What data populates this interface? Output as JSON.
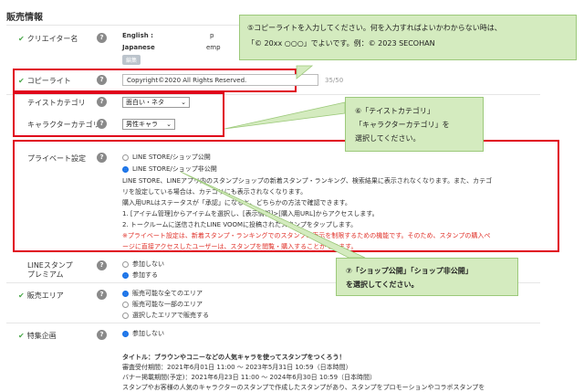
{
  "section_title": "販売情報",
  "creator": {
    "label": "クリエイター名",
    "english_label": "English :",
    "english_value": "p",
    "japanese_label": "Japanese",
    "japanese_value": "emp",
    "edit_button": "編集"
  },
  "copyright": {
    "label": "コピーライト",
    "value": "Copyright©2020 All Rights Reserved.",
    "counter": "35/50"
  },
  "taste": {
    "label": "テイストカテゴリ",
    "value": "面白い・ネタ"
  },
  "character": {
    "label": "キャラクターカテゴリ",
    "value": "男性キャラ"
  },
  "private": {
    "label": "プライベート設定",
    "options": [
      "LINE STORE/ショップ公開",
      "LINE STORE/ショップ非公開"
    ],
    "desc": [
      "LINE STORE、LINEアプリ内のスタンプショップの新着スタンプ・ランキング、検索結果に表示されなくなります。また、カテゴ",
      "リを設定している場合は、カテゴリにも表示されなくなります。",
      "購入用URLはステータスが「承認」になると、どちらかの方法で確認できます。",
      "1. [アイテム管理]からアイテムを選択し、[表示情報]>[購入用URL]からアクセスします。",
      "2. トークルームに送信されたLINE VOOMに投稿されたスタンプをタップします。"
    ],
    "warning": [
      "※プライベート設定は、新着スタンプ・ランキングでのスタンプの表示を制限するための機能です。そのため、スタンプの購入ペ",
      "ージに直接アクセスしたユーザーは、スタンプを閲覧・購入することができます。"
    ]
  },
  "premium": {
    "label1": "LINEスタンプ",
    "label2": "プレミアム",
    "options": [
      "参加しない",
      "参加する"
    ]
  },
  "area": {
    "label": "販売エリア",
    "options": [
      "販売可能な全てのエリア",
      "販売可能な一部のエリア",
      "選択したエリアで販売する"
    ]
  },
  "special": {
    "label": "特集企画",
    "option": "参加しない",
    "event_title": "タイトル：ブラウンやコニーなどの人気キャラを使ってスタンプをつくろう！",
    "event_period1": "審査受付期間：2021年6月01日 11:00 ～ 2023年5月31日 10:59（日本時間）",
    "event_period2": "バナー掲載期間(予定)：2021年6月23日 11:00 ～ 2024年6月30日 10:59（日本時間）",
    "event_cut": "スタンプやお客様の人気のキャラクターのスタンプで作成したスタンプがあり、スタンプをプロモーションやコラボスタンプを"
  },
  "callout5": {
    "line1": "⑤コピーライトを入力してください。何を入力すればよいかわからない時は、",
    "line2": "「© 20xx ○○○」でよいです。例：© 2023 SECOHAN"
  },
  "callout6": {
    "line1": "⑥「テイストカテゴリ」",
    "line2": "「キャラクターカテゴリ」を",
    "line3": "選択してください。"
  },
  "callout7": {
    "line1": "⑦「ショップ公開」「ショップ非公開」",
    "line2": "を選択してください。"
  },
  "colors": {
    "highlight_border": "#e0001b",
    "callout_bg": "#d4ebbf",
    "warning_text": "#e0322a",
    "radio_selected": "#1a73e8"
  }
}
